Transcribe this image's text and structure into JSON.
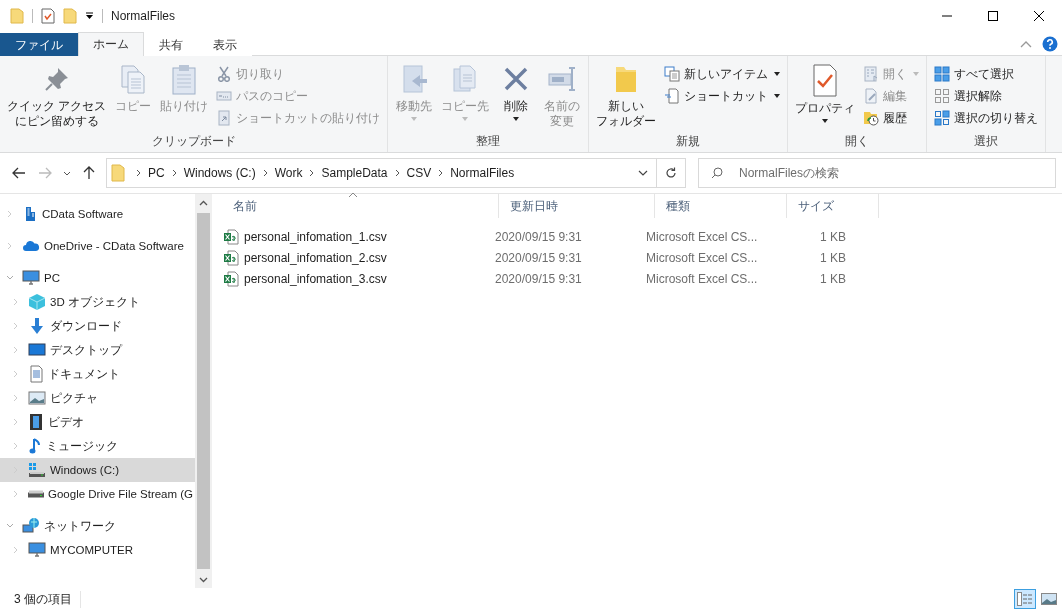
{
  "window": {
    "title": "NormalFiles"
  },
  "ribbon_tabs": [
    {
      "label": "ファイル",
      "kind": "file",
      "selected": false
    },
    {
      "label": "ホーム",
      "kind": "tab",
      "selected": true
    },
    {
      "label": "共有",
      "kind": "tab",
      "selected": false
    },
    {
      "label": "表示",
      "kind": "tab",
      "selected": false
    }
  ],
  "ribbon_groups": [
    {
      "label": "クリップボード",
      "items": [
        {
          "kind": "large",
          "lines": [
            "クイック アクセス",
            "にピン留めする"
          ],
          "disabled": false,
          "dropdown": false
        },
        {
          "kind": "large",
          "lines": [
            "コピー"
          ],
          "disabled": true,
          "dropdown": false
        },
        {
          "kind": "large",
          "lines": [
            "貼り付け"
          ],
          "disabled": true,
          "dropdown": false
        },
        {
          "kind": "stack",
          "items": [
            {
              "label": "切り取り",
              "disabled": true,
              "dropdown": false
            },
            {
              "label": "パスのコピー",
              "disabled": true,
              "dropdown": false
            },
            {
              "label": "ショートカットの貼り付け",
              "disabled": true,
              "dropdown": false
            }
          ]
        }
      ]
    },
    {
      "label": "整理",
      "items": [
        {
          "kind": "large",
          "lines": [
            "移動先"
          ],
          "disabled": true,
          "dropdown": true
        },
        {
          "kind": "large",
          "lines": [
            "コピー先"
          ],
          "disabled": true,
          "dropdown": true
        },
        {
          "kind": "large",
          "lines": [
            "削除"
          ],
          "disabled": false,
          "dropdown": true
        },
        {
          "kind": "large",
          "lines": [
            "名前の",
            "変更"
          ],
          "disabled": true,
          "dropdown": false
        }
      ]
    },
    {
      "label": "新規",
      "items": [
        {
          "kind": "large",
          "lines": [
            "新しい",
            "フォルダー"
          ],
          "disabled": false,
          "dropdown": false
        },
        {
          "kind": "stack",
          "items": [
            {
              "label": "新しいアイテム",
              "disabled": false,
              "dropdown": true
            },
            {
              "label": "ショートカット",
              "disabled": false,
              "dropdown": true
            }
          ]
        }
      ]
    },
    {
      "label": "開く",
      "items": [
        {
          "kind": "large",
          "lines": [
            "プロパティ"
          ],
          "disabled": false,
          "dropdown": true
        },
        {
          "kind": "stack",
          "items": [
            {
              "label": "開く",
              "disabled": true,
              "dropdown": true
            },
            {
              "label": "編集",
              "disabled": true,
              "dropdown": false
            },
            {
              "label": "履歴",
              "disabled": false,
              "dropdown": false
            }
          ]
        }
      ]
    },
    {
      "label": "選択",
      "items": [
        {
          "kind": "stack",
          "items": [
            {
              "label": "すべて選択",
              "disabled": false,
              "dropdown": false
            },
            {
              "label": "選択解除",
              "disabled": false,
              "dropdown": false
            },
            {
              "label": "選択の切り替え",
              "disabled": false,
              "dropdown": false
            }
          ]
        }
      ]
    }
  ],
  "address": {
    "breadcrumb": [
      "PC",
      "Windows (C:)",
      "Work",
      "SampleData",
      "CSV",
      "NormalFiles"
    ]
  },
  "search": {
    "placeholder": "NormalFilesの検索"
  },
  "nav_tree": [
    {
      "label": "CData Software",
      "expanded": false,
      "selected": false
    },
    {
      "label": "OneDrive - CData Software",
      "expanded": false,
      "selected": false
    },
    {
      "label": "PC",
      "expanded": true,
      "selected": false,
      "children": [
        {
          "label": "3D オブジェクト",
          "expanded": false,
          "selected": false
        },
        {
          "label": "ダウンロード",
          "expanded": false,
          "selected": false
        },
        {
          "label": "デスクトップ",
          "expanded": false,
          "selected": false
        },
        {
          "label": "ドキュメント",
          "expanded": false,
          "selected": false
        },
        {
          "label": "ピクチャ",
          "expanded": false,
          "selected": false
        },
        {
          "label": "ビデオ",
          "expanded": false,
          "selected": false
        },
        {
          "label": "ミュージック",
          "expanded": false,
          "selected": false
        },
        {
          "label": "Windows (C:)",
          "expanded": false,
          "selected": true
        },
        {
          "label": "Google Drive File Stream (G",
          "expanded": false,
          "selected": false
        }
      ]
    },
    {
      "label": "ネットワーク",
      "expanded": true,
      "selected": false,
      "children": [
        {
          "label": "MYCOMPUTER",
          "expanded": false,
          "selected": false
        }
      ]
    }
  ],
  "file_list": {
    "columns": [
      {
        "label": "名前",
        "sorted": true
      },
      {
        "label": "更新日時",
        "sorted": false
      },
      {
        "label": "種類",
        "sorted": false
      },
      {
        "label": "サイズ",
        "sorted": false
      }
    ],
    "rows": [
      {
        "name": "personal_infomation_1.csv",
        "modified": "2020/09/15 9:31",
        "type": "Microsoft Excel CS...",
        "size": "1 KB"
      },
      {
        "name": "personal_infomation_2.csv",
        "modified": "2020/09/15 9:31",
        "type": "Microsoft Excel CS...",
        "size": "1 KB"
      },
      {
        "name": "personal_infomation_3.csv",
        "modified": "2020/09/15 9:31",
        "type": "Microsoft Excel CS...",
        "size": "1 KB"
      }
    ]
  },
  "status_bar": {
    "item_count": "3 個の項目",
    "view_buttons": [
      {
        "selected": true
      },
      {
        "selected": false
      }
    ]
  }
}
